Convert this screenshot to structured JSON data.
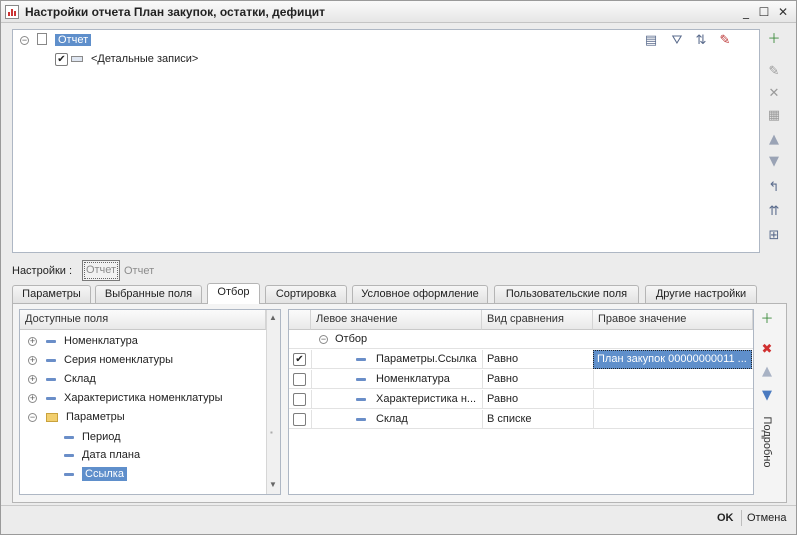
{
  "window": {
    "title": "Настройки отчета  План закупок, остатки, дефицит",
    "controls": {
      "min": "_",
      "max": "☐",
      "close": "✕"
    }
  },
  "top_tree": {
    "root_label": "Отчет",
    "child_label": "<Детальные записи>",
    "child_checked": true
  },
  "settings_bar": {
    "label": "Настройки :",
    "btn1": "Отчет",
    "btn2": "Отчет"
  },
  "tabs": [
    {
      "label": "Параметры",
      "active": false
    },
    {
      "label": "Выбранные поля",
      "active": false
    },
    {
      "label": "Отбор",
      "active": true
    },
    {
      "label": "Сортировка",
      "active": false
    },
    {
      "label": "Условное оформление",
      "active": false
    },
    {
      "label": "Пользовательские поля",
      "active": false
    },
    {
      "label": "Другие настройки",
      "active": false
    }
  ],
  "available_fields": {
    "header": "Доступные поля",
    "items": [
      {
        "label": "Номенклатура",
        "expander": "+"
      },
      {
        "label": "Серия номенклатуры",
        "expander": "+"
      },
      {
        "label": "Склад",
        "expander": "+"
      },
      {
        "label": "Характеристика номенклатуры",
        "expander": "+"
      },
      {
        "label": "Параметры",
        "expander": "−"
      }
    ],
    "sub_items": [
      {
        "label": "Период"
      },
      {
        "label": "Дата плана"
      },
      {
        "label": "Ссылка",
        "selected": true
      }
    ]
  },
  "filter_grid": {
    "columns": [
      "Левое значение",
      "Вид сравнения",
      "Правое значение"
    ],
    "group_label": "Отбор",
    "rows": [
      {
        "checked": true,
        "left": "Параметры.Ссылка",
        "comparison": "Равно",
        "right": "План закупок 00000000011 ..."
      },
      {
        "checked": false,
        "left": "Номенклатура",
        "comparison": "Равно",
        "right": ""
      },
      {
        "checked": false,
        "left": "Характеристика н...",
        "comparison": "Равно",
        "right": ""
      },
      {
        "checked": false,
        "left": "Склад",
        "comparison": "В списке",
        "right": ""
      }
    ]
  },
  "side_label": "Подробно",
  "footer": {
    "ok": "OK",
    "cancel": "Отмена"
  },
  "colors": {
    "selection": "#5f8fcb",
    "border": "#aeb7c4"
  }
}
